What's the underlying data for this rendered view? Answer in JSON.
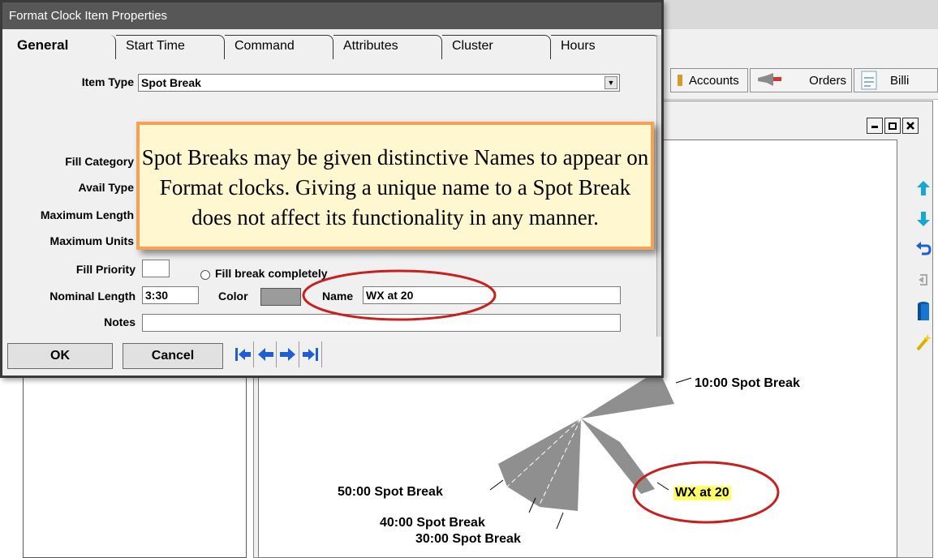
{
  "dialog": {
    "title": "Format Clock Item Properties",
    "tabs": [
      "General",
      "Start Time",
      "Command",
      "Attributes",
      "Cluster",
      "Hours"
    ],
    "fields": {
      "item_type_label": "Item Type",
      "item_type_value": "Spot Break",
      "fill_category_label": "Fill Category",
      "avail_type_label": "Avail Type",
      "maximum_length_label": "Maximum Length",
      "maximum_units_label": "Maximum Units",
      "fill_priority_label": "Fill Priority",
      "fill_priority_value": "",
      "fill_break_completely_label": "Fill break completely",
      "nominal_length_label": "Nominal Length",
      "nominal_length_value": "3:30",
      "color_label": "Color",
      "name_label": "Name",
      "name_value": "WX at 20",
      "notes_label": "Notes",
      "notes_value": ""
    },
    "buttons": {
      "ok": "OK",
      "cancel": "Cancel"
    },
    "nav_icons": [
      "first-record-icon",
      "previous-record-icon",
      "next-record-icon",
      "last-record-icon"
    ]
  },
  "toolbar": {
    "accounts_label": "Accounts",
    "orders_label": "Orders",
    "billing_label": "Billi"
  },
  "window_controls": [
    "minimize-icon",
    "restore-icon",
    "close-icon"
  ],
  "right_tools": [
    "move-up-icon",
    "move-down-icon",
    "undo-icon",
    "redo-icon",
    "column-icon",
    "wand-icon"
  ],
  "callout": {
    "text": "Spot Breaks may be given distinctive Names to appear on Format clocks. Giving a unique name to a Spot Break does not affect its functionality in any manner."
  },
  "clock_labels": {
    "ten": "10:00 Spot Break",
    "fifty": "50:00 Spot Break",
    "forty": "40:00 Spot Break",
    "thirty": "30:00 Spot Break",
    "wx": "WX at 20"
  },
  "colors": {
    "highlight_ring": "#c8201e",
    "callout_border": "#f5a257",
    "callout_fill": "#fef7cf",
    "wedge": "#8f8f8f",
    "label_highlight": "#ffff66",
    "nav_arrow": "#1f5fd1"
  }
}
